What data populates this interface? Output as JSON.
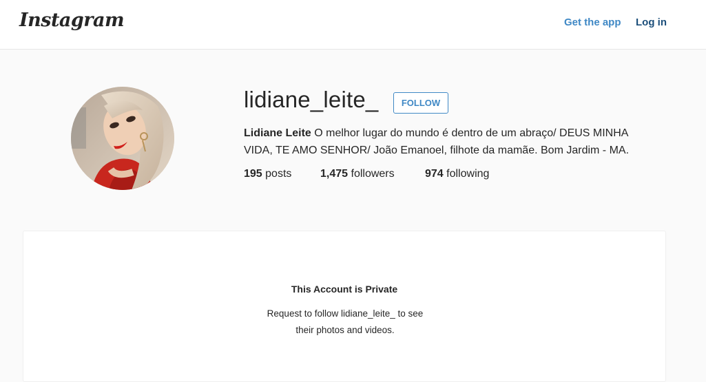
{
  "header": {
    "logo_text": "Instagram",
    "get_app_label": "Get the app",
    "login_label": "Log in"
  },
  "profile": {
    "username": "lidiane_leite_",
    "follow_label": "FOLLOW",
    "full_name": "Lidiane Leite",
    "bio": "O melhor lugar do mundo é dentro de um abraço/ DEUS MINHA VIDA, TE AMO SENHOR/ João Emanoel, filhote da mamãe. Bom Jardim - MA.",
    "stats": {
      "posts_count": "195",
      "posts_label": "posts",
      "followers_count": "1,475",
      "followers_label": "followers",
      "following_count": "974",
      "following_label": "following"
    }
  },
  "private_notice": {
    "title": "This Account is Private",
    "message": "Request to follow lidiane_leite_ to see their photos and videos."
  },
  "colors": {
    "accent_blue": "#3f88c5",
    "login_blue": "#1c4f7b",
    "background": "#fafafa",
    "text": "#262626"
  }
}
